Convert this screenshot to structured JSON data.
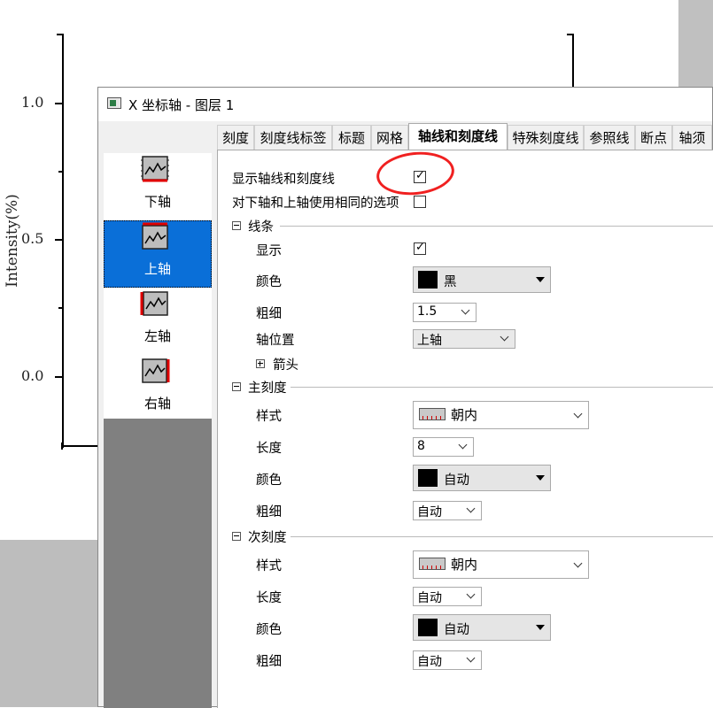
{
  "plot": {
    "y_axis_label": "Intensity(%)",
    "y_ticks": [
      "1.0",
      "0.5",
      "0.0"
    ]
  },
  "dialog": {
    "title": "X 坐标轴 - 图层 1",
    "axes_list": [
      {
        "label": "下轴",
        "selected": false
      },
      {
        "label": "上轴",
        "selected": true
      },
      {
        "label": "左轴",
        "selected": false
      },
      {
        "label": "右轴",
        "selected": false
      }
    ],
    "tabs": [
      "刻度",
      "刻度线标签",
      "标题",
      "网格",
      "轴线和刻度线",
      "特殊刻度线",
      "参照线",
      "断点",
      "轴须"
    ],
    "active_tab": "轴线和刻度线",
    "show_axis_and_ticks": {
      "label": "显示轴线和刻度线",
      "checked": true
    },
    "same_options": {
      "label": "对下轴和上轴使用相同的选项",
      "checked": false
    },
    "line_section": {
      "header": "线条",
      "show_label": "显示",
      "show_checked": true,
      "color_label": "颜色",
      "color_value": "黑",
      "width_label": "粗细",
      "width_value": "1.5",
      "position_label": "轴位置",
      "position_value": "上轴",
      "arrow_label": "箭头"
    },
    "major_section": {
      "header": "主刻度",
      "style_label": "样式",
      "style_value": "朝内",
      "length_label": "长度",
      "length_value": "8",
      "color_label": "颜色",
      "color_value": "自动",
      "width_label": "粗细",
      "width_value": "自动"
    },
    "minor_section": {
      "header": "次刻度",
      "style_label": "样式",
      "style_value": "朝内",
      "length_label": "长度",
      "length_value": "自动",
      "color_label": "颜色",
      "color_value": "自动",
      "width_label": "粗细",
      "width_value": "自动"
    }
  },
  "colors": {
    "selection": "#0a6fd8",
    "annotation_circle": "#f02020",
    "dialog_bg": "#f0f0f0"
  }
}
